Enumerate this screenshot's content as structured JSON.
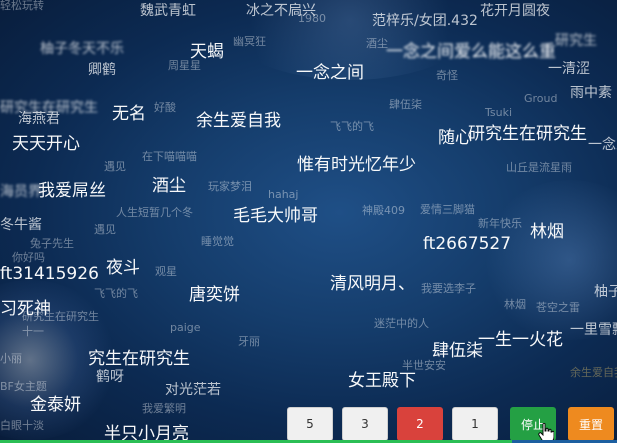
{
  "danmaku": [
    {
      "text": "魏武青虹",
      "cls": "s2"
    },
    {
      "text": "冰之不扃兴",
      "cls": "s2"
    },
    {
      "text": "1980",
      "cls": "s3"
    },
    {
      "text": "范梓乐/女团.432",
      "cls": "s2"
    },
    {
      "text": "花开月圆夜",
      "cls": "s2"
    },
    {
      "text": "柚子冬天不乐",
      "cls": "s2 blur"
    },
    {
      "text": "天蝎",
      "cls": "s1"
    },
    {
      "text": "幽冥狂",
      "cls": "s3"
    },
    {
      "text": "酒尘",
      "cls": "s3"
    },
    {
      "text": "一念之间爱么能这么重",
      "cls": "s1 blur"
    },
    {
      "text": "研究生",
      "cls": "s2 blur"
    },
    {
      "text": "卿鹤",
      "cls": "s2"
    },
    {
      "text": "周星星",
      "cls": "s3"
    },
    {
      "text": "一念之间",
      "cls": "s1"
    },
    {
      "text": "奇怪",
      "cls": "s3"
    },
    {
      "text": "一清涩",
      "cls": "s2"
    },
    {
      "text": "Groud",
      "cls": "s3"
    },
    {
      "text": "雨中素",
      "cls": "s2"
    },
    {
      "text": "研究生在研究生",
      "cls": "s2 blur"
    },
    {
      "text": "好酸",
      "cls": "s3"
    },
    {
      "text": "无名",
      "cls": "s1"
    },
    {
      "text": "肆伍柒",
      "cls": "s3"
    },
    {
      "text": "Tsuki",
      "cls": "s3"
    },
    {
      "text": "海燕君",
      "cls": "s2"
    },
    {
      "text": "余生爱自我",
      "cls": "s1"
    },
    {
      "text": "飞飞的飞",
      "cls": "s3"
    },
    {
      "text": "随心",
      "cls": "s1"
    },
    {
      "text": "研究生在研究生",
      "cls": "s1"
    },
    {
      "text": "一念之",
      "cls": "s2"
    },
    {
      "text": "天天开心",
      "cls": "s1"
    },
    {
      "text": "在下喵喵喵",
      "cls": "s3"
    },
    {
      "text": "惟有时光忆年少",
      "cls": "s1"
    },
    {
      "text": "山丘是流星雨",
      "cls": "s3"
    },
    {
      "text": "遇见",
      "cls": "s3"
    },
    {
      "text": "海员界",
      "cls": "s2 blur"
    },
    {
      "text": "酒尘",
      "cls": "s1"
    },
    {
      "text": "玩家梦泪",
      "cls": "s3"
    },
    {
      "text": "我爱屌丝",
      "cls": "s1"
    },
    {
      "text": "hahaj",
      "cls": "s3"
    },
    {
      "text": "人生短暂几个冬",
      "cls": "s3"
    },
    {
      "text": "毛毛大帅哥",
      "cls": "s1"
    },
    {
      "text": "神殿409",
      "cls": "s3"
    },
    {
      "text": "爱情三脚猫",
      "cls": "s3"
    },
    {
      "text": "冬牛酱",
      "cls": "s2"
    },
    {
      "text": "遇见",
      "cls": "s3"
    },
    {
      "text": "新年快乐",
      "cls": "s3"
    },
    {
      "text": "林烟",
      "cls": "s1"
    },
    {
      "text": "兔子先生",
      "cls": "s3"
    },
    {
      "text": "睡觉觉",
      "cls": "s3"
    },
    {
      "text": "ft2667527",
      "cls": "s1"
    },
    {
      "text": "你好吗",
      "cls": "s3"
    },
    {
      "text": "夜斗",
      "cls": "s1"
    },
    {
      "text": "观星",
      "cls": "s3"
    },
    {
      "text": "ft31415926",
      "cls": "s1"
    },
    {
      "text": "清风明月、",
      "cls": "s1"
    },
    {
      "text": "我要选李子",
      "cls": "s3"
    },
    {
      "text": "唐奕饼",
      "cls": "s1"
    },
    {
      "text": "飞飞的飞",
      "cls": "s3"
    },
    {
      "text": "林烟",
      "cls": "s3"
    },
    {
      "text": "苍空之雷",
      "cls": "s3"
    },
    {
      "text": "柚子",
      "cls": "s2"
    },
    {
      "text": "习死神",
      "cls": "s1"
    },
    {
      "text": "研究生在研究生",
      "cls": "s3"
    },
    {
      "text": "paige",
      "cls": "s3"
    },
    {
      "text": "迷茫中的人",
      "cls": "s3"
    },
    {
      "text": "十一",
      "cls": "s3"
    },
    {
      "text": "一生一火花",
      "cls": "s1"
    },
    {
      "text": "一里雪飘",
      "cls": "s2"
    },
    {
      "text": "牙丽",
      "cls": "s3"
    },
    {
      "text": "肆伍柒",
      "cls": "s1"
    },
    {
      "text": "小丽",
      "cls": "s3"
    },
    {
      "text": "究生在研究生",
      "cls": "s1"
    },
    {
      "text": "鹤呀",
      "cls": "s2"
    },
    {
      "text": "半世安安",
      "cls": "s3"
    },
    {
      "text": "女王殿下",
      "cls": "s1"
    },
    {
      "text": "余生爱自我",
      "cls": "s3 gold"
    },
    {
      "text": "BF女主题",
      "cls": "s3"
    },
    {
      "text": "对光茫若",
      "cls": "s2"
    },
    {
      "text": "金泰妍",
      "cls": "s1"
    },
    {
      "text": "我爱繁明",
      "cls": "s3"
    },
    {
      "text": "白眼十淡",
      "cls": "s3"
    },
    {
      "text": "半只小月亮",
      "cls": "s1"
    },
    {
      "text": "轻松玩转",
      "cls": "s3"
    }
  ],
  "controls": {
    "speed_5": "5",
    "speed_3": "3",
    "speed_2": "2",
    "speed_1": "1",
    "stop": "停止",
    "reset": "重置"
  },
  "colors": {
    "background": "#153d6c",
    "active_speed": "#d9423c",
    "stop": "#24a044",
    "reset": "#ee8a1f",
    "progress": "#2bbf55"
  },
  "progress": 0.83,
  "cursor": "hand-pointer-icon"
}
